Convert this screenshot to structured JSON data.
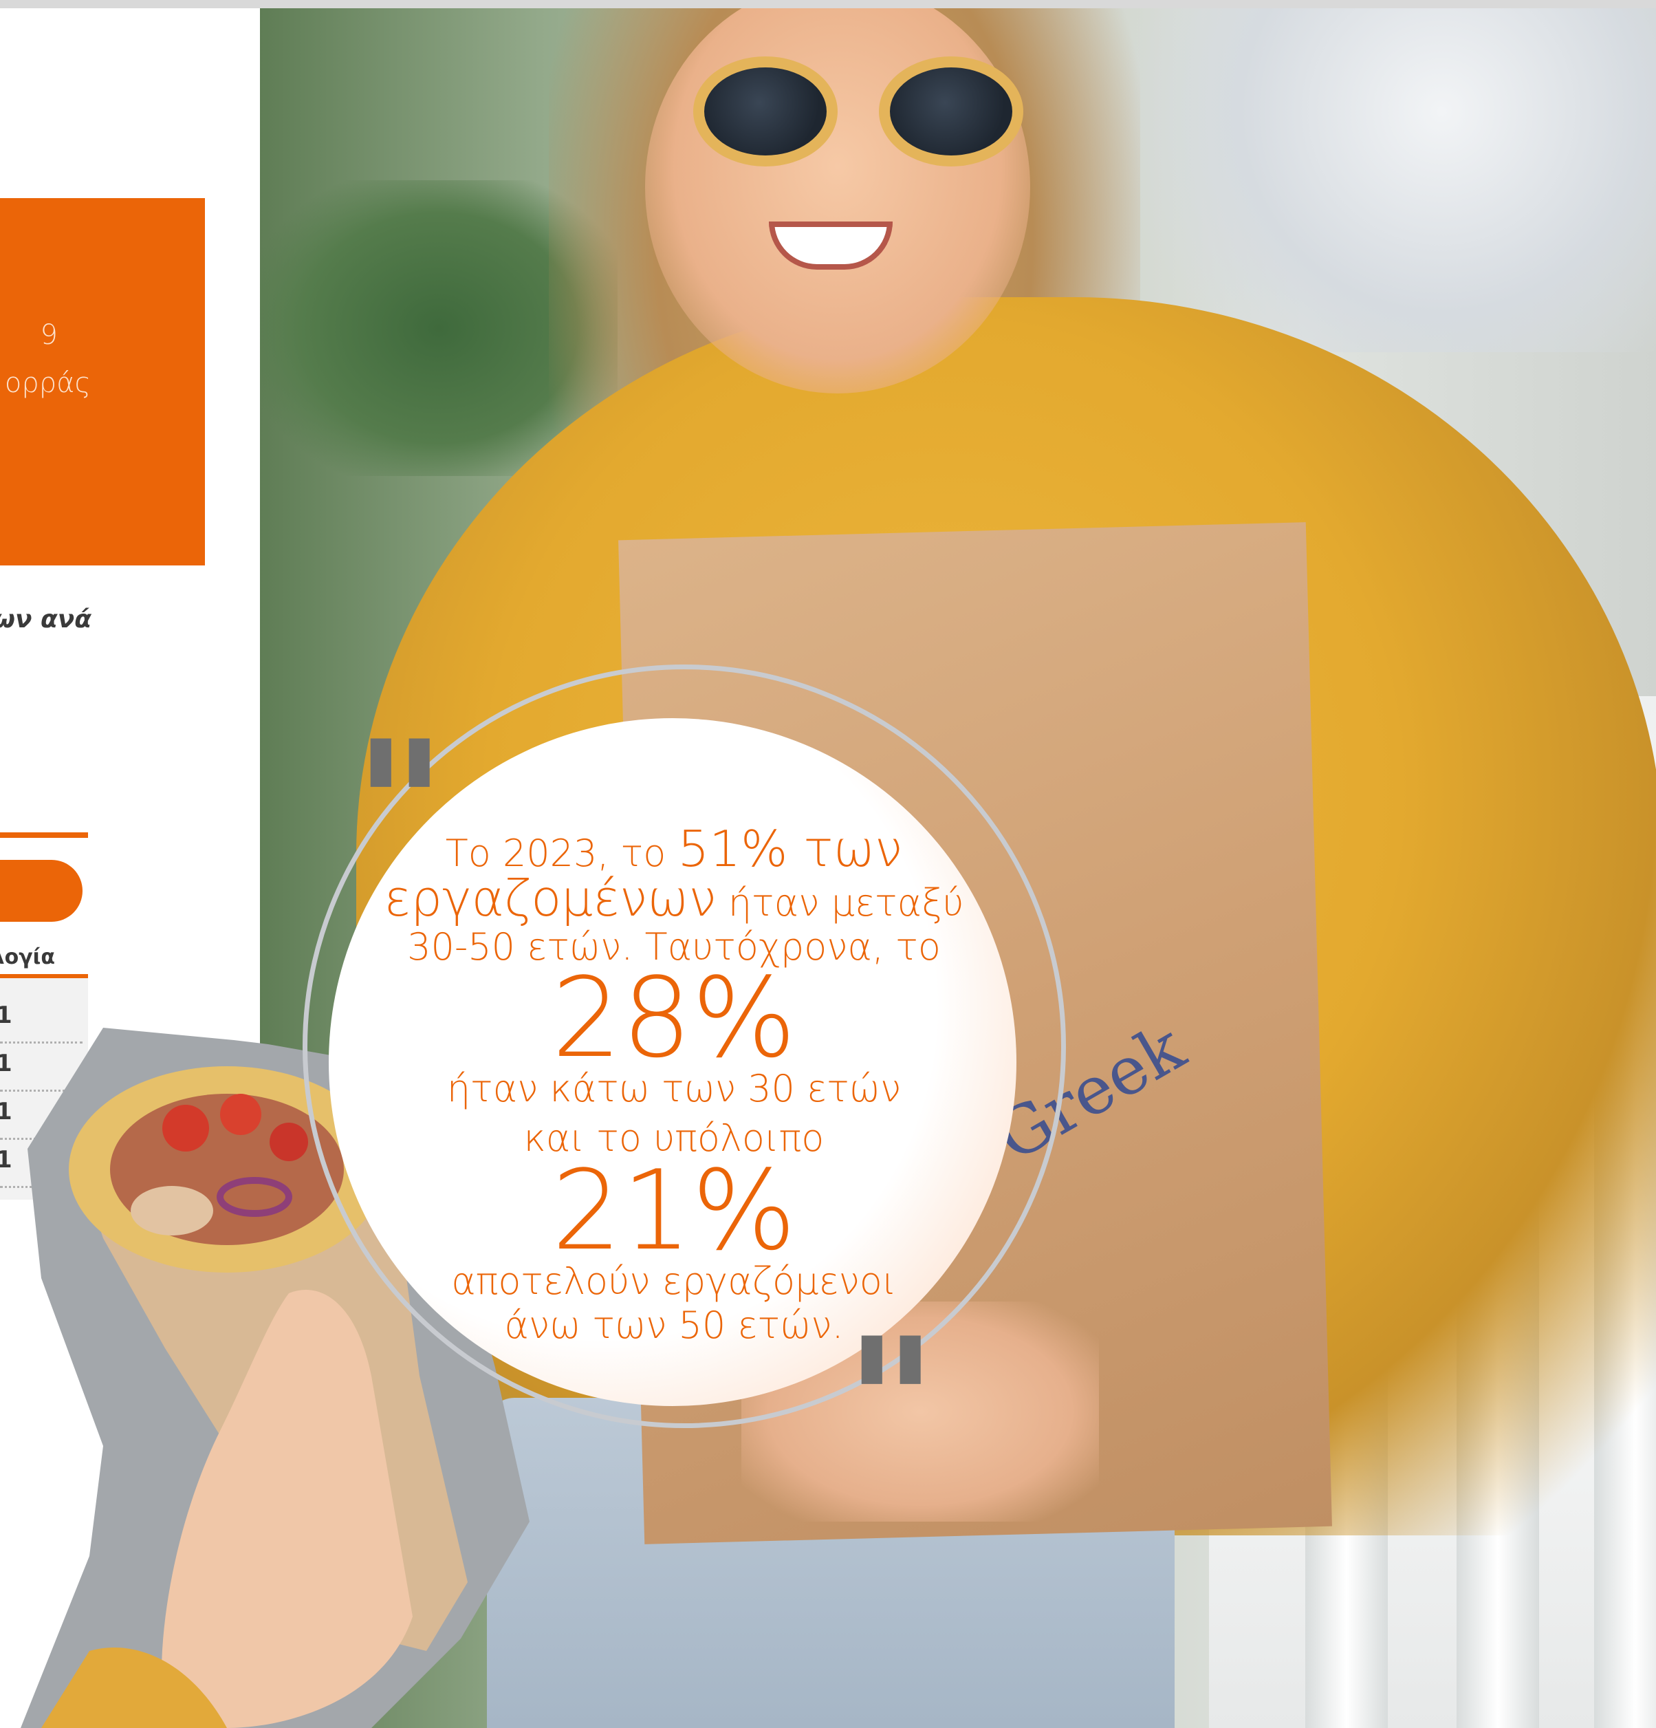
{
  "left_column": {
    "orange_box_lines": [
      "9",
      "ορράς"
    ],
    "italic_fragment": "των ανά",
    "table": {
      "column_header": "λογία",
      "rows": [
        "1",
        "1",
        "1",
        "1"
      ]
    }
  },
  "quote": {
    "line1_pre": "Το 2023, το ",
    "line1_highlight": "51% των",
    "line2_highlight": "εργαζομένων",
    "line2_post": " ήταν μεταξύ",
    "line3": "30-50 ετών. Ταυτόχρονα, το",
    "stat1": "28%",
    "line5": "ήταν κάτω των 30 ετών",
    "line6": "και το υπόλοιπο",
    "stat2": "21%",
    "line8": "αποτελούν εργαζόμενοι",
    "line9": "άνω των 50 ετών."
  },
  "photo": {
    "bag_logo_text": "Greek"
  },
  "colors": {
    "accent": "#eb6508",
    "quote_mark": "#6f6f6f",
    "ring": "#c8cbd0"
  }
}
